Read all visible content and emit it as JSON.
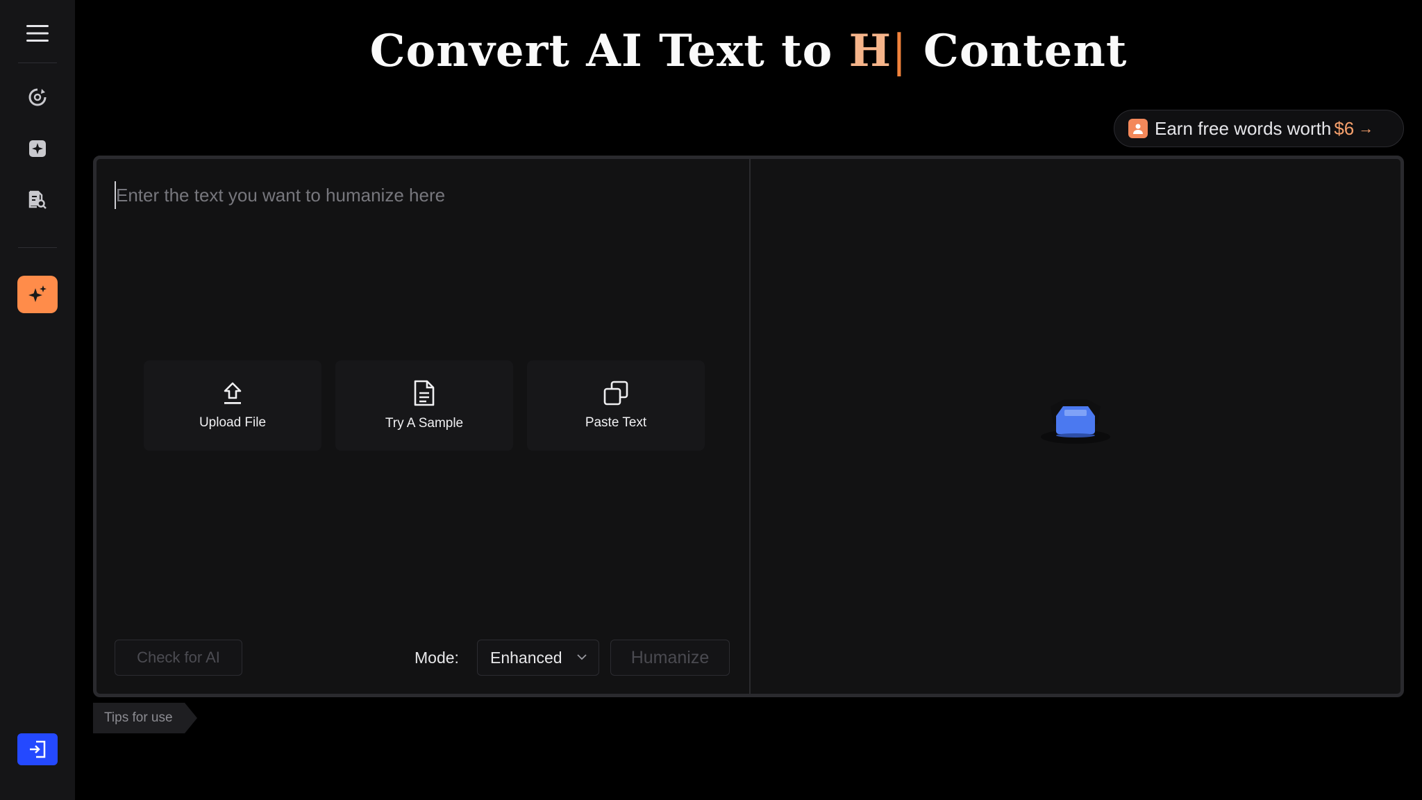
{
  "title": {
    "part1": "Convert AI Text to ",
    "highlight": "H",
    "caret": "|",
    "part2": " Content"
  },
  "earn": {
    "label": "Earn free words worth",
    "amount": "$6",
    "arrow": "→"
  },
  "editor": {
    "placeholder": "Enter the text you want to humanize here",
    "actions": [
      {
        "label": "Upload File",
        "icon": "upload-icon"
      },
      {
        "label": "Try A Sample",
        "icon": "document-icon"
      },
      {
        "label": "Paste Text",
        "icon": "copy-icon"
      }
    ],
    "check_label": "Check for AI",
    "mode_label": "Mode:",
    "mode_value": "Enhanced",
    "humanize_label": "Humanize"
  },
  "tips_label": "Tips for use",
  "sidebar": {
    "items": [
      {
        "icon": "menu-icon"
      },
      {
        "icon": "refresh-cycle-icon"
      },
      {
        "icon": "sparkle-box-icon"
      },
      {
        "icon": "document-search-icon"
      },
      {
        "icon": "sparkles-icon"
      },
      {
        "icon": "login-icon"
      }
    ]
  },
  "colors": {
    "accent": "#ff8c4a",
    "highlight": "#f5b48a",
    "login_blue": "#2449ff",
    "background": "#000000",
    "panel": "#121213"
  }
}
